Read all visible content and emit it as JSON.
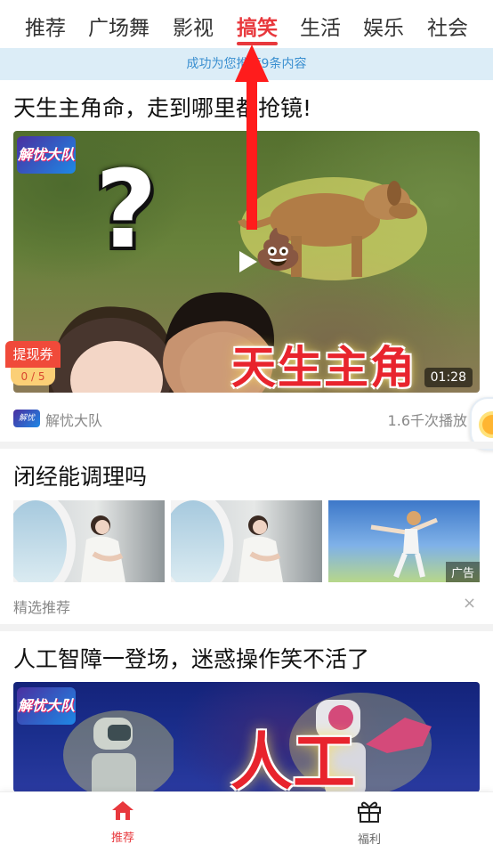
{
  "tabs": [
    {
      "label": "推荐"
    },
    {
      "label": "广场舞"
    },
    {
      "label": "影视"
    },
    {
      "label": "搞笑",
      "active": true
    },
    {
      "label": "生活"
    },
    {
      "label": "娱乐"
    },
    {
      "label": "社会"
    }
  ],
  "toast": {
    "text": "成功为您推荐9条内容"
  },
  "feed": {
    "item1": {
      "title": "天生主角命，走到哪里都抢镜!",
      "channel_badge": "解忧大队",
      "overlay_text": "天生主角",
      "duration": "01:28",
      "coupon": {
        "label": "提现券",
        "progress": "0 / 5"
      },
      "author": "解忧大队",
      "plays": "1.6千次播放"
    },
    "ad": {
      "title": "闭经能调理吗",
      "tag": "广告",
      "label": "精选推荐",
      "close": "×"
    },
    "item2": {
      "title": "人工智障一登场，迷惑操作笑不活了",
      "channel_badge": "解忧大队",
      "overlay_text": "人工"
    }
  },
  "bottom_nav": {
    "home": {
      "label": "推荐",
      "icon": "home-icon",
      "active": true
    },
    "welfare": {
      "label": "福利",
      "icon": "gift-icon"
    }
  },
  "colors": {
    "accent": "#e8383d",
    "toast_bg": "#dcedf7",
    "toast_text": "#3a8fd0"
  }
}
